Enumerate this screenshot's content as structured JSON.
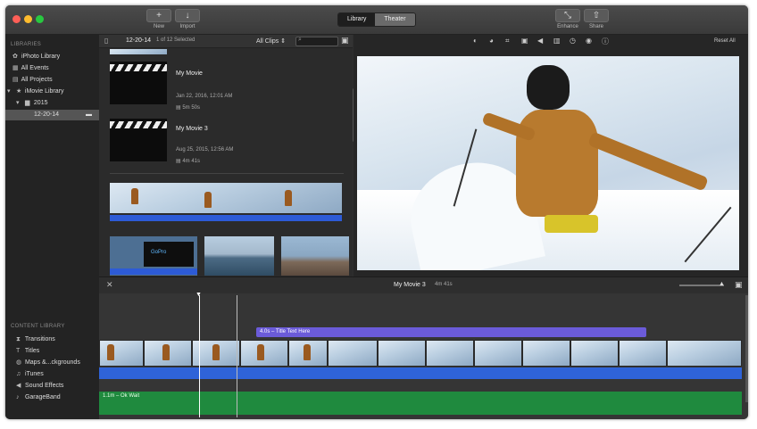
{
  "toolbar": {
    "new_label": "New",
    "import_label": "Import",
    "library_tab": "Library",
    "theater_tab": "Theater",
    "enhance_label": "Enhance",
    "share_label": "Share",
    "traffic_colors": [
      "#ff5f57",
      "#febc2e",
      "#28c840"
    ]
  },
  "sidebar": {
    "libraries_header": "LIBRARIES",
    "items": [
      {
        "label": "iPhoto Library",
        "icon": "photo-icon"
      },
      {
        "label": "All Events",
        "icon": "events-icon"
      },
      {
        "label": "All Projects",
        "icon": "projects-icon"
      },
      {
        "label": "iMovie Library",
        "icon": "star-icon"
      },
      {
        "label": "2015",
        "icon": "folder-icon"
      },
      {
        "label": "12-20-14",
        "icon": "event-icon"
      }
    ],
    "content_header": "CONTENT LIBRARY",
    "content_items": [
      {
        "label": "Transitions",
        "icon": "transitions-icon"
      },
      {
        "label": "Titles",
        "icon": "titles-icon"
      },
      {
        "label": "Maps &...ckgrounds",
        "icon": "globe-icon"
      },
      {
        "label": "iTunes",
        "icon": "music-note-icon"
      },
      {
        "label": "Sound Effects",
        "icon": "speaker-icon"
      },
      {
        "label": "GarageBand",
        "icon": "guitar-icon"
      }
    ]
  },
  "browser": {
    "event_name": "12-20-14",
    "selection_info": "1 of 12 Selected",
    "filter": "All Clips",
    "projects": [
      {
        "title": "My Movie",
        "date": "Jan 22, 2016, 12:01 AM",
        "duration": "5m 50s"
      },
      {
        "title": "My Movie 3",
        "date": "Aug 25, 2015, 12:56 AM",
        "duration": "4m 41s"
      }
    ],
    "overlay_text": "GoPro"
  },
  "viewer": {
    "reset_all": "Reset All"
  },
  "timeline": {
    "project_title": "My Movie 3",
    "project_duration": "4m 41s",
    "title_clip": "4.0s – Title Text Here",
    "music_clip": "1.1m – Ok Wait"
  }
}
